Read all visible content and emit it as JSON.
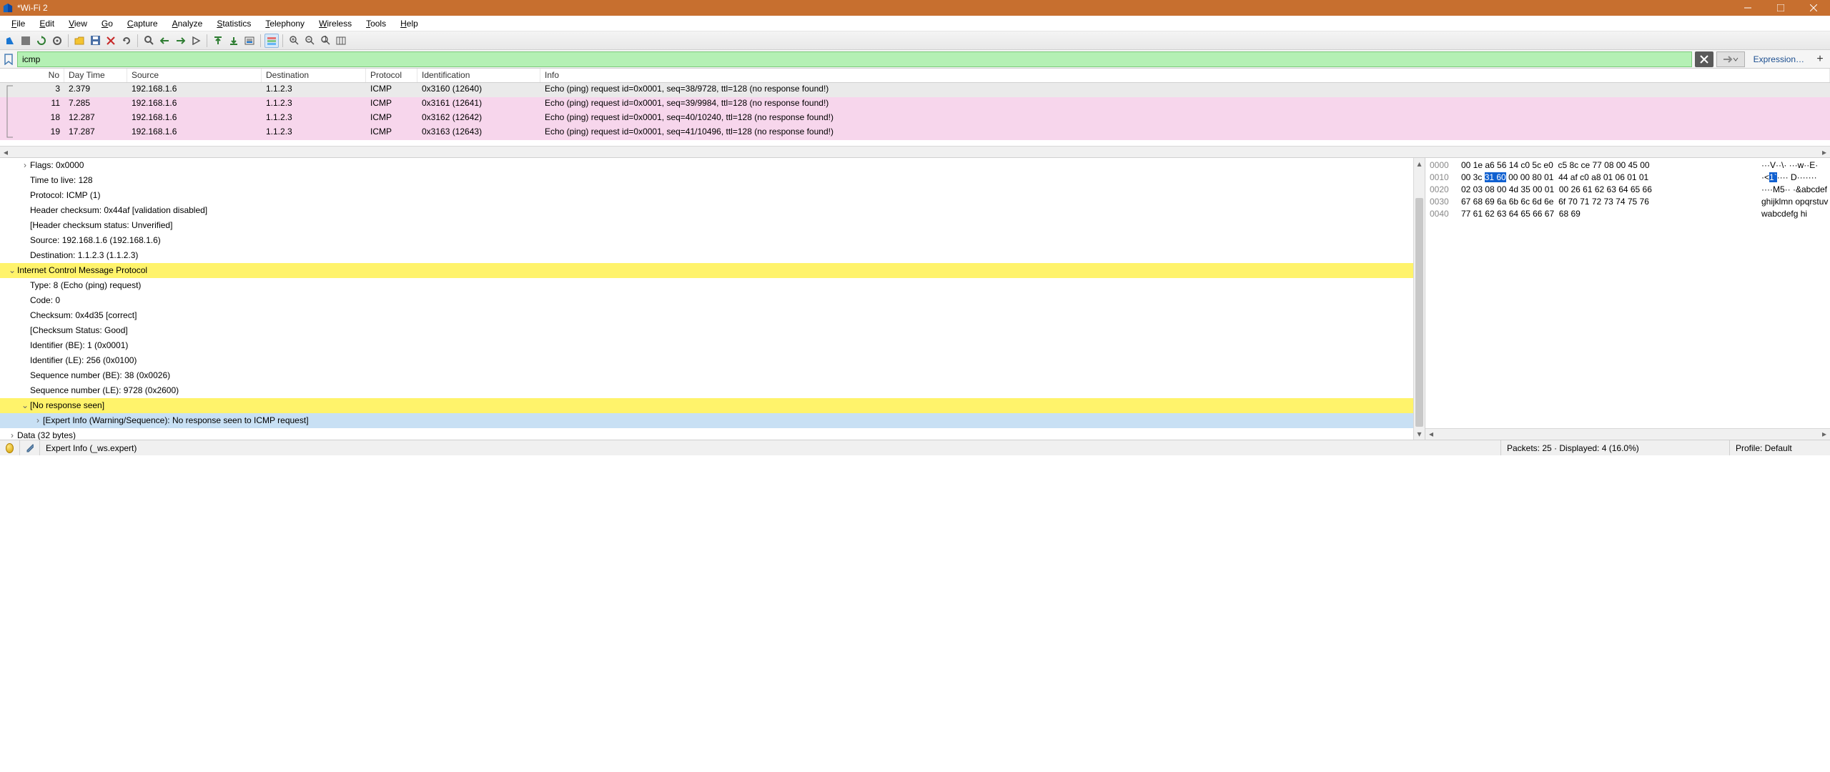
{
  "window": {
    "title": "*Wi-Fi 2"
  },
  "menu": [
    "File",
    "Edit",
    "View",
    "Go",
    "Capture",
    "Analyze",
    "Statistics",
    "Telephony",
    "Wireless",
    "Tools",
    "Help"
  ],
  "filter": {
    "value": "icmp",
    "expression_label": "Expression…"
  },
  "columns": [
    "No",
    "Day Time",
    "Source",
    "Destination",
    "Protocol",
    "Identification",
    "Info"
  ],
  "packets": [
    {
      "no": "3",
      "time": "2.379",
      "src": "192.168.1.6",
      "dst": "1.1.2.3",
      "proto": "ICMP",
      "id": "0x3160 (12640)",
      "info": "Echo (ping) request  id=0x0001, seq=38/9728, ttl=128 (no response found!)",
      "cls": "r0"
    },
    {
      "no": "11",
      "time": "7.285",
      "src": "192.168.1.6",
      "dst": "1.1.2.3",
      "proto": "ICMP",
      "id": "0x3161 (12641)",
      "info": "Echo (ping) request  id=0x0001, seq=39/9984, ttl=128 (no response found!)",
      "cls": "pink"
    },
    {
      "no": "18",
      "time": "12.287",
      "src": "192.168.1.6",
      "dst": "1.1.2.3",
      "proto": "ICMP",
      "id": "0x3162 (12642)",
      "info": "Echo (ping) request  id=0x0001, seq=40/10240, ttl=128 (no response found!)",
      "cls": "pink"
    },
    {
      "no": "19",
      "time": "17.287",
      "src": "192.168.1.6",
      "dst": "1.1.2.3",
      "proto": "ICMP",
      "id": "0x3163 (12643)",
      "info": "Echo (ping) request  id=0x0001, seq=41/10496, ttl=128 (no response found!)",
      "cls": "pink"
    }
  ],
  "details": [
    {
      "t": "Flags: 0x0000",
      "tw": ">",
      "ind": 1
    },
    {
      "t": "Time to live: 128",
      "ind": 1
    },
    {
      "t": "Protocol: ICMP (1)",
      "ind": 1
    },
    {
      "t": "Header checksum: 0x44af [validation disabled]",
      "ind": 1
    },
    {
      "t": "[Header checksum status: Unverified]",
      "ind": 1
    },
    {
      "t": "Source: 192.168.1.6 (192.168.1.6)",
      "ind": 1
    },
    {
      "t": "Destination: 1.1.2.3 (1.1.2.3)",
      "ind": 1
    },
    {
      "t": "Internet Control Message Protocol",
      "tw": "v",
      "ind": 0,
      "hl": true
    },
    {
      "t": "Type: 8 (Echo (ping) request)",
      "ind": 1
    },
    {
      "t": "Code: 0",
      "ind": 1
    },
    {
      "t": "Checksum: 0x4d35 [correct]",
      "ind": 1
    },
    {
      "t": "[Checksum Status: Good]",
      "ind": 1
    },
    {
      "t": "Identifier (BE): 1 (0x0001)",
      "ind": 1
    },
    {
      "t": "Identifier (LE): 256 (0x0100)",
      "ind": 1
    },
    {
      "t": "Sequence number (BE): 38 (0x0026)",
      "ind": 1
    },
    {
      "t": "Sequence number (LE): 9728 (0x2600)",
      "ind": 1
    },
    {
      "t": "[No response seen]",
      "tw": "v",
      "ind": 1,
      "hl": true
    },
    {
      "t": "[Expert Info (Warning/Sequence): No response seen to ICMP request]",
      "tw": ">",
      "ind": 2,
      "sel": true
    },
    {
      "t": "Data (32 bytes)",
      "tw": ">",
      "ind": 0
    }
  ],
  "hex": [
    {
      "off": "0000",
      "b": "00 1e a6 56 14 c0 5c e0  c5 8c ce 77 08 00 45 00",
      "a": "···V··\\· ···w··E·"
    },
    {
      "off": "0010",
      "b": "00 3c <HL>31 60</HL> 00 00 80 01  44 af c0 a8 01 06 01 01",
      "a": "·<<HL>1`</HL>···· D·······"
    },
    {
      "off": "0020",
      "b": "02 03 08 00 4d 35 00 01  00 26 61 62 63 64 65 66",
      "a": "····M5·· ·&abcdef"
    },
    {
      "off": "0030",
      "b": "67 68 69 6a 6b 6c 6d 6e  6f 70 71 72 73 74 75 76",
      "a": "ghijklmn opqrstuv"
    },
    {
      "off": "0040",
      "b": "77 61 62 63 64 65 66 67  68 69",
      "a": "wabcdefg hi"
    }
  ],
  "status": {
    "expert": "Expert Info (_ws.expert)",
    "packets": "Packets: 25 · Displayed: 4 (16.0%)",
    "profile": "Profile: Default"
  }
}
